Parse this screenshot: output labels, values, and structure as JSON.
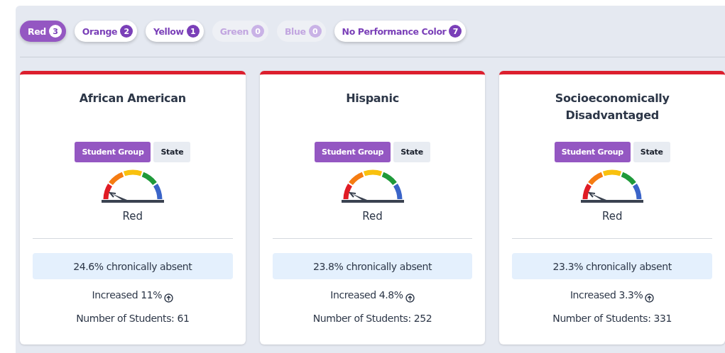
{
  "filters": [
    {
      "label": "Red",
      "count": "3",
      "selected": true,
      "disabled": false
    },
    {
      "label": "Orange",
      "count": "2",
      "selected": false,
      "disabled": false
    },
    {
      "label": "Yellow",
      "count": "1",
      "selected": false,
      "disabled": false
    },
    {
      "label": "Green",
      "count": "0",
      "selected": false,
      "disabled": true
    },
    {
      "label": "Blue",
      "count": "0",
      "selected": false,
      "disabled": true
    },
    {
      "label": "No Performance Color",
      "count": "7",
      "selected": false,
      "disabled": false
    }
  ],
  "cards": [
    {
      "title": "African American",
      "toggle": [
        {
          "label": "Student Group",
          "selected": true
        },
        {
          "label": "State",
          "selected": false
        }
      ],
      "performance": "Red",
      "rate": "24.6% chronically absent",
      "change": "Increased 11%",
      "students": "Number of Students: 61"
    },
    {
      "title": "Hispanic",
      "toggle": [
        {
          "label": "Student Group",
          "selected": true
        },
        {
          "label": "State",
          "selected": false
        }
      ],
      "performance": "Red",
      "rate": "23.8% chronically absent",
      "change": "Increased 4.8%",
      "students": "Number of Students: 252"
    },
    {
      "title": "Socioeconomically Disadvantaged",
      "toggle": [
        {
          "label": "Student Group",
          "selected": true
        },
        {
          "label": "State",
          "selected": false
        }
      ],
      "performance": "Red",
      "rate": "23.3% chronically absent",
      "change": "Increased 3.3%",
      "students": "Number of Students: 331"
    }
  ]
}
